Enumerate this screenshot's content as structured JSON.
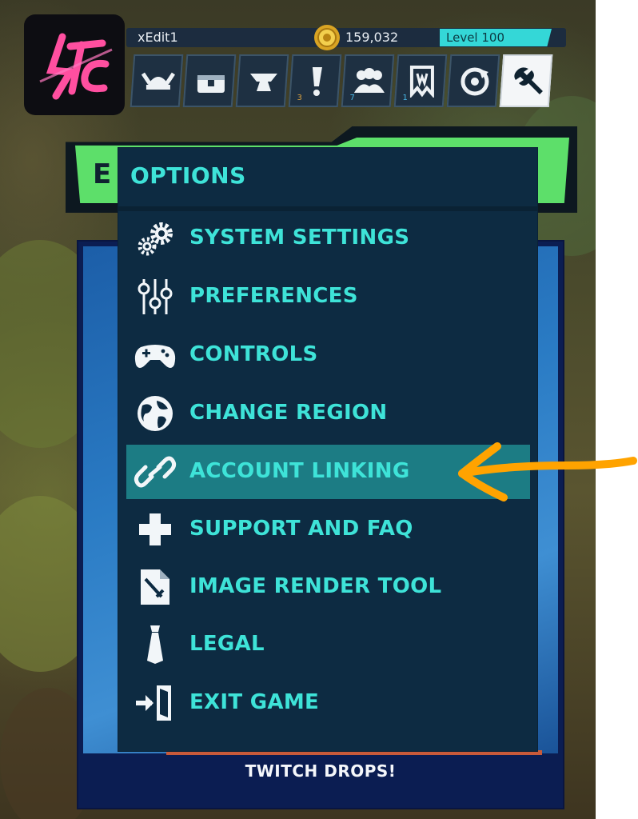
{
  "hud": {
    "username": "xEdit1",
    "coins": "159,032",
    "level": "Level 100",
    "tabs": [
      {
        "icon": "viking-helmet-icon",
        "badge": ""
      },
      {
        "icon": "chest-icon",
        "badge": ""
      },
      {
        "icon": "anvil-icon",
        "badge": ""
      },
      {
        "icon": "exclamation-icon",
        "badge": "3"
      },
      {
        "icon": "group-icon",
        "badge": "7"
      },
      {
        "icon": "banner-icon",
        "badge": "1"
      },
      {
        "icon": "refresh-icon",
        "badge": ""
      },
      {
        "icon": "wrench-icon",
        "badge": ""
      }
    ]
  },
  "banner": {
    "text": "E"
  },
  "options": {
    "title": "OPTIONS",
    "items": [
      {
        "label": "SYSTEM SETTINGS",
        "icon": "gears-icon"
      },
      {
        "label": "PREFERENCES",
        "icon": "sliders-icon"
      },
      {
        "label": "CONTROLS",
        "icon": "gamepad-icon"
      },
      {
        "label": "CHANGE REGION",
        "icon": "globe-icon"
      },
      {
        "label": "ACCOUNT LINKING",
        "icon": "link-icon",
        "highlighted": true
      },
      {
        "label": "SUPPORT AND FAQ",
        "icon": "plus-icon"
      },
      {
        "label": "IMAGE RENDER TOOL",
        "icon": "sword-file-icon"
      },
      {
        "label": "LEGAL",
        "icon": "tie-icon"
      },
      {
        "label": "EXIT GAME",
        "icon": "exit-door-icon"
      }
    ]
  },
  "card": {
    "label": "TWITCH DROPS!"
  },
  "colors": {
    "accent": "#3ee3d8",
    "panel": "#0d2b42",
    "highlight": "#1c7c84",
    "arrow": "#ffa300",
    "banner": "#5ddf6a"
  }
}
